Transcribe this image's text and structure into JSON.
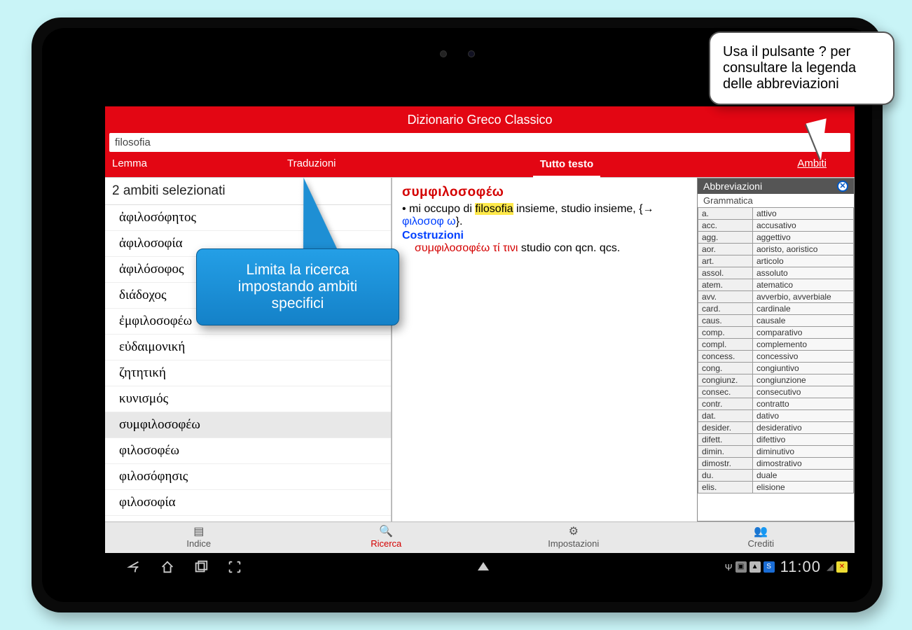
{
  "app_title": "Dizionario Greco Classico",
  "search_value": "filosofia",
  "tabs": {
    "lemma": "Lemma",
    "traduzioni": "Traduzioni",
    "tutto": "Tutto testo",
    "ambiti": "Ambiti"
  },
  "selected_count_label": "2 ambiti selezionati",
  "lemmas": [
    "ἀφιλοσόφητος",
    "ἀφιλοσοφία",
    "ἀφιλόσοφος",
    "διάδοχος",
    "ἐμφιλοσοφέω",
    "εὐδαιμονική",
    "ζητητική",
    "κυνισμός",
    "συμφιλοσοφέω",
    "φιλοσοφέω",
    "φιλοσόφησις",
    "φιλοσοφία"
  ],
  "selected_lemma_index": 8,
  "entry": {
    "headword": "συμφιλοσοφέω",
    "line1_pre": " • mi occupo di ",
    "line1_hi": "filosofia",
    "line1_post": " insieme, studio insieme, {→ ",
    "line1_link": "φιλοσοφ ω",
    "line1_end": "}.",
    "costruzioni": "Costruzioni",
    "constr_greek": "συμφιλοσοφέω τί τινι",
    "constr_rest": " studio con qcn. qcs."
  },
  "abbr_panel": {
    "title": "Abbreviazioni",
    "subtitle": "Grammatica",
    "rows": [
      [
        "a.",
        "attivo"
      ],
      [
        "acc.",
        "accusativo"
      ],
      [
        "agg.",
        "aggettivo"
      ],
      [
        "aor.",
        "aoristo, aoristico"
      ],
      [
        "art.",
        "articolo"
      ],
      [
        "assol.",
        "assoluto"
      ],
      [
        "atem.",
        "atematico"
      ],
      [
        "avv.",
        "avverbio, avverbiale"
      ],
      [
        "card.",
        "cardinale"
      ],
      [
        "caus.",
        "causale"
      ],
      [
        "comp.",
        "comparativo"
      ],
      [
        "compl.",
        "complemento"
      ],
      [
        "concess.",
        "concessivo"
      ],
      [
        "cong.",
        "congiuntivo"
      ],
      [
        "congiunz.",
        "congiunzione"
      ],
      [
        "consec.",
        "consecutivo"
      ],
      [
        "contr.",
        "contratto"
      ],
      [
        "dat.",
        "dativo"
      ],
      [
        "desider.",
        "desiderativo"
      ],
      [
        "difett.",
        "difettivo"
      ],
      [
        "dimin.",
        "diminutivo"
      ],
      [
        "dimostr.",
        "dimostrativo"
      ],
      [
        "du.",
        "duale"
      ],
      [
        "elis.",
        "elisione"
      ]
    ]
  },
  "bottom": {
    "indice": "Indice",
    "ricerca": "Ricerca",
    "impostazioni": "Impostazioni",
    "crediti": "Crediti"
  },
  "callout_blue": "Limita la ricerca impostando ambiti specifici",
  "callout_white": "Usa il pulsante ? per consultare la legenda delle abbreviazioni",
  "clock": "11:00"
}
